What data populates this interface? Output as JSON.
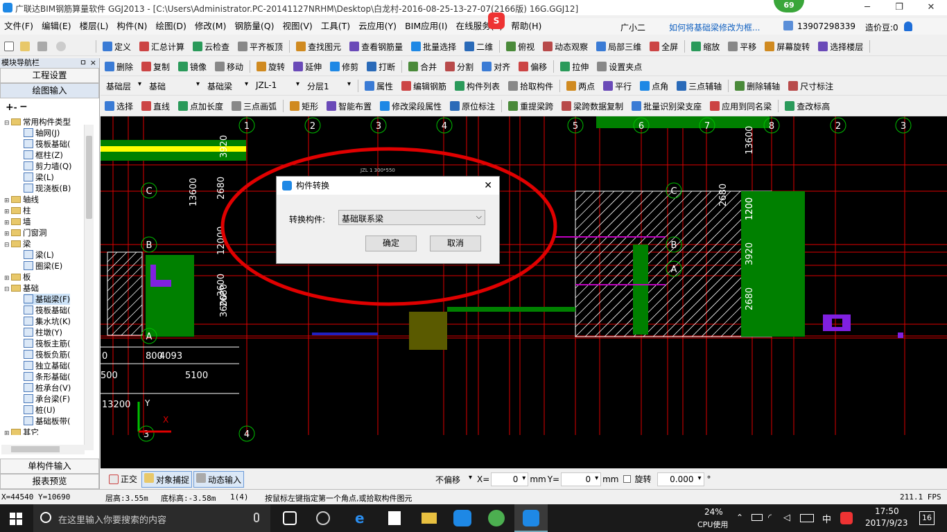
{
  "window": {
    "title": "广联达BIM钢筋算量软件 GGJ2013 - [C:\\Users\\Administrator.PC-20141127NRHM\\Desktop\\白龙村-2016-08-25-13-27-07(2166版) 16G.GGJ12]",
    "minimize": "─",
    "maximize": "❐",
    "close": "✕",
    "badge": "69"
  },
  "menu": [
    "文件(F)",
    "编辑(E)",
    "楼层(L)",
    "构件(N)",
    "绘图(D)",
    "修改(M)",
    "钢筋量(Q)",
    "视图(V)",
    "工具(T)",
    "云应用(Y)",
    "BIM应用(I)",
    "在线服务(S)",
    "帮助(H)"
  ],
  "menu_right": {
    "assistant": "广小二",
    "question": "如何将基础梁修改为框...",
    "phone": "13907298339",
    "beans": "造价豆:0"
  },
  "tb1": [
    "定义",
    "汇总计算",
    "云检查",
    "平齐板顶",
    "查找图元",
    "查看钢筋量",
    "批量选择",
    "二维",
    "俯视",
    "动态观察",
    "局部三维",
    "全屏",
    "缩放",
    "平移",
    "屏幕旋转",
    "选择楼层"
  ],
  "tb2": [
    "删除",
    "复制",
    "镜像",
    "移动",
    "旋转",
    "延伸",
    "修剪",
    "打断",
    "合并",
    "分割",
    "对齐",
    "偏移",
    "拉伸",
    "设置夹点"
  ],
  "tb3": {
    "dropdowns": [
      "基础层",
      "基础",
      "基础梁",
      "JZL-1",
      "分层1"
    ],
    "buttons": [
      "属性",
      "编辑钢筋",
      "构件列表",
      "拾取构件",
      "两点",
      "平行",
      "点角",
      "三点辅轴",
      "删除辅轴",
      "尺寸标注"
    ]
  },
  "tb4": [
    "选择",
    "直线",
    "点加长度",
    "三点画弧",
    "矩形",
    "智能布置",
    "修改梁段属性",
    "原位标注",
    "重提梁跨",
    "梁跨数据复制",
    "批量识别梁支座",
    "应用到同名梁",
    "查改标高"
  ],
  "panel": {
    "title": "模块导航栏",
    "pin": "ㅁ",
    "close": "×",
    "btn1": "工程设置",
    "btn2": "绘图输入",
    "btn3": "单构件输入",
    "btn4": "报表预览"
  },
  "tree": [
    {
      "lvl": 0,
      "exp": "⊟",
      "kind": "folder",
      "label": "常用构件类型"
    },
    {
      "lvl": 1,
      "kind": "item",
      "label": "轴网(J)"
    },
    {
      "lvl": 1,
      "kind": "item",
      "label": "筏板基础("
    },
    {
      "lvl": 1,
      "kind": "item",
      "label": "框柱(Z)"
    },
    {
      "lvl": 1,
      "kind": "item",
      "label": "剪力墙(Q)"
    },
    {
      "lvl": 1,
      "kind": "item",
      "label": "梁(L)"
    },
    {
      "lvl": 1,
      "kind": "item",
      "label": "现浇板(B)"
    },
    {
      "lvl": 0,
      "exp": "⊞",
      "kind": "folder",
      "label": "轴线"
    },
    {
      "lvl": 0,
      "exp": "⊞",
      "kind": "folder",
      "label": "柱"
    },
    {
      "lvl": 0,
      "exp": "⊞",
      "kind": "folder",
      "label": "墙"
    },
    {
      "lvl": 0,
      "exp": "⊞",
      "kind": "folder",
      "label": "门窗洞"
    },
    {
      "lvl": 0,
      "exp": "⊟",
      "kind": "folder",
      "label": "梁"
    },
    {
      "lvl": 1,
      "kind": "item",
      "label": "梁(L)"
    },
    {
      "lvl": 1,
      "kind": "item",
      "label": "圈梁(E)"
    },
    {
      "lvl": 0,
      "exp": "⊞",
      "kind": "folder",
      "label": "板"
    },
    {
      "lvl": 0,
      "exp": "⊟",
      "kind": "folder",
      "label": "基础"
    },
    {
      "lvl": 1,
      "kind": "item",
      "label": "基础梁(F)",
      "selected": true
    },
    {
      "lvl": 1,
      "kind": "item",
      "label": "筏板基础("
    },
    {
      "lvl": 1,
      "kind": "item",
      "label": "集水坑(K)"
    },
    {
      "lvl": 1,
      "kind": "item",
      "label": "柱墩(Y)"
    },
    {
      "lvl": 1,
      "kind": "item",
      "label": "筏板主筋("
    },
    {
      "lvl": 1,
      "kind": "item",
      "label": "筏板负筋("
    },
    {
      "lvl": 1,
      "kind": "item",
      "label": "独立基础("
    },
    {
      "lvl": 1,
      "kind": "item",
      "label": "条形基础("
    },
    {
      "lvl": 1,
      "kind": "item",
      "label": "桩承台(V)"
    },
    {
      "lvl": 1,
      "kind": "item",
      "label": "承台梁(F)"
    },
    {
      "lvl": 1,
      "kind": "item",
      "label": "桩(U)"
    },
    {
      "lvl": 1,
      "kind": "item",
      "label": "基础板带("
    },
    {
      "lvl": 0,
      "exp": "⊞",
      "kind": "folder",
      "label": "其它"
    }
  ],
  "canvas": {
    "axis_labels": [
      "1",
      "2",
      "3",
      "4",
      "5",
      "6",
      "7",
      "8",
      "2",
      "3",
      "C",
      "B",
      "A",
      "C",
      "B",
      "A",
      "3",
      "4"
    ],
    "dims": [
      "3920",
      "13600",
      "2680",
      "12000",
      "3600",
      "3600",
      "2680",
      "1200",
      "3920",
      "13600",
      "2680",
      "1200",
      "2680",
      "800",
      "4093",
      "5100",
      "13200",
      "500",
      "0"
    ],
    "small": "JZL 1 300*550"
  },
  "dialog": {
    "title": "构件转换",
    "label": "转换构件:",
    "value": "基础联系梁",
    "ok": "确定",
    "cancel": "取消",
    "close": "✕"
  },
  "status": {
    "ortho": "正交",
    "snap": "对象捕捉",
    "dyn": "动态输入",
    "offset": "不偏移",
    "x_label": "X=",
    "x": "0",
    "y_label": "Y=",
    "y": "0",
    "unit": "mm",
    "rotate": "旋转",
    "angle": "0.000",
    "deg": "°"
  },
  "info": {
    "coords": "X=44540 Y=10690",
    "floor_h": "层高:3.55m",
    "base_h": "底标高:-3.58m",
    "count": "1(4)",
    "hint": "按鼠标左键指定第一个角点,或拾取构件图元",
    "fps": "211.1 FPS"
  },
  "taskbar": {
    "search": "在这里输入你要搜索的内容",
    "cpu_pct": "24%",
    "cpu_label": "CPU使用",
    "ime": "中",
    "time": "17:50",
    "date": "2017/9/23",
    "notif": "16"
  },
  "colors": {
    "red": "#e00000",
    "green": "#008000",
    "yellow": "#ffff00",
    "magenta": "#c000c0",
    "blue": "#2020c0"
  }
}
